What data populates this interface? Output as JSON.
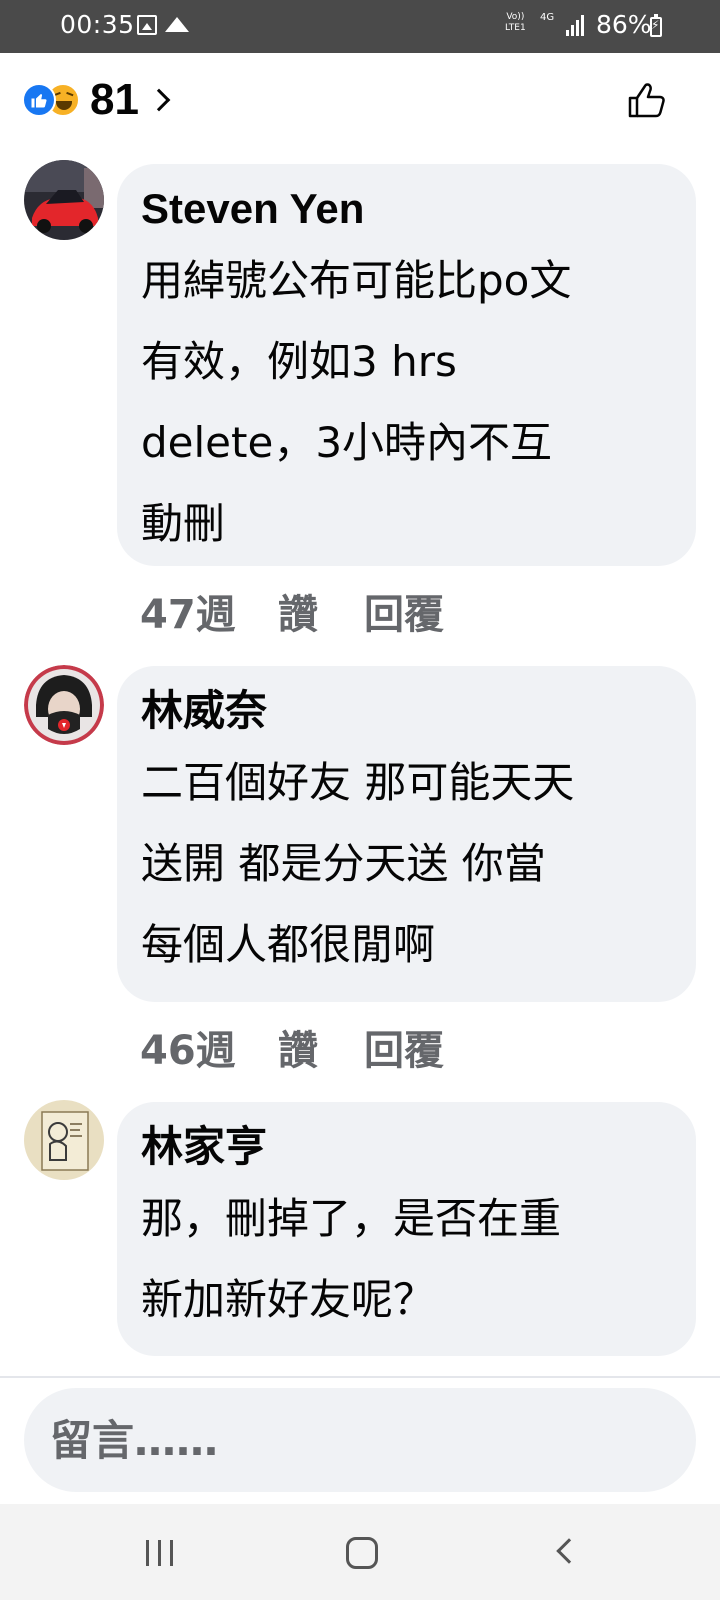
{
  "status_bar": {
    "time": "00:35",
    "volte_top": "Vo))",
    "volte_bottom": "LTE1",
    "network": "4G",
    "battery": "86%"
  },
  "reactions": {
    "count": "81",
    "icons": [
      "like-icon",
      "haha-icon"
    ],
    "like_color": "#1877f2",
    "haha_color": "#f7b125"
  },
  "comments": [
    {
      "author": "Steven Yen",
      "lines": [
        "用綽號公布可能比po文",
        "有效，例如3 hrs",
        "delete，3小時內不互",
        "動刪"
      ],
      "time": "47週",
      "like": "讚",
      "reply": "回覆"
    },
    {
      "author": "林威奈",
      "lines": [
        "二百個好友 那可能天天",
        "送開 都是分天送 你當",
        "每個人都很閒啊"
      ],
      "time": "46週",
      "like": "讚",
      "reply": "回覆"
    },
    {
      "author": "林家亨",
      "lines": [
        "那，刪掉了，是否在重",
        "新加新好友呢？"
      ]
    }
  ],
  "composer": {
    "placeholder": "留言……"
  },
  "colors": {
    "bubble": "#f0f2f5",
    "meta_text": "#65676b",
    "status_bar": "#4a4a4a"
  }
}
